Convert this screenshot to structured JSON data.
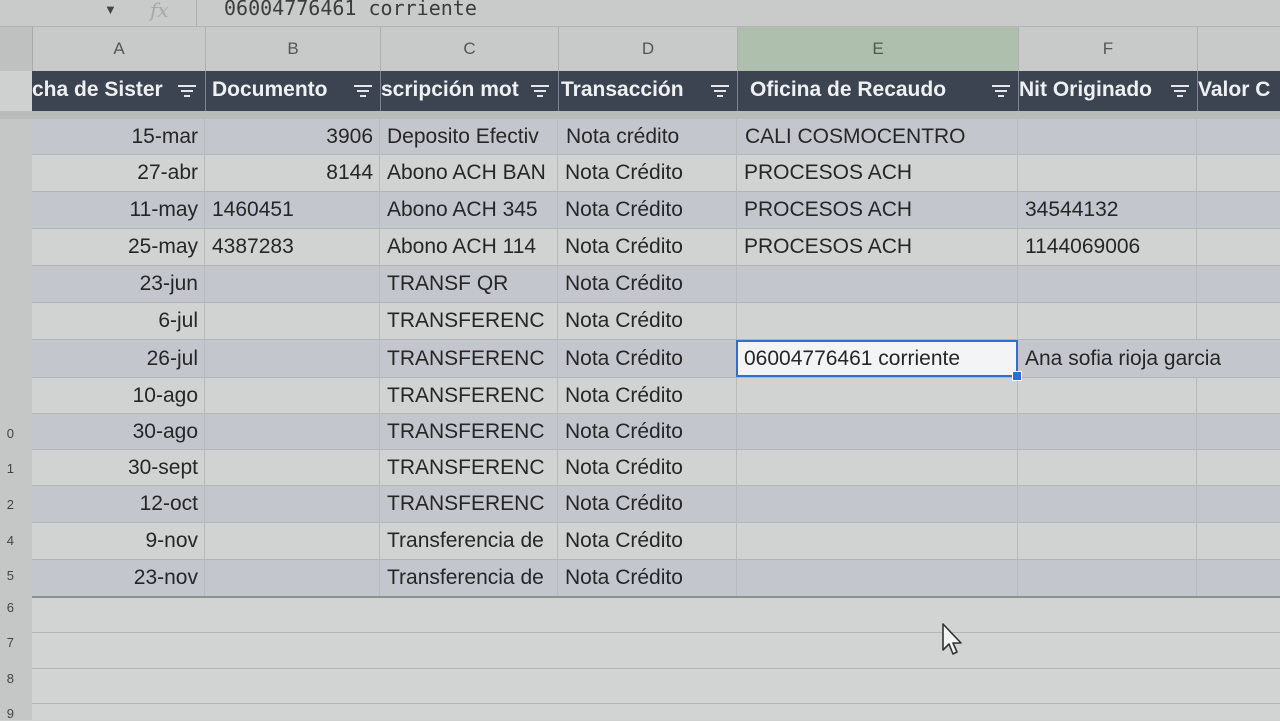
{
  "formula_bar": {
    "fx_label": "fx",
    "value": "06004776461 corriente"
  },
  "columns": [
    "A",
    "B",
    "C",
    "D",
    "E",
    "F"
  ],
  "filter_headers": [
    "cha de Sister",
    "Documento",
    "scripción mot",
    "Transacción",
    "Oficina de Recaudo",
    "Nit Originado",
    "Valor C"
  ],
  "rows": [
    {
      "num": "",
      "a": "15-mar",
      "b": "3906",
      "c": "Deposito Efectiv",
      "d": "Nota crédito",
      "e": "CALI COSMOCENTRO",
      "f": ""
    },
    {
      "num": "",
      "a": "27-abr",
      "b": "8144",
      "c": "Abono ACH BAN",
      "d": "Nota Crédito",
      "e": "PROCESOS ACH",
      "f": ""
    },
    {
      "num": "",
      "a": "11-may",
      "b": "1460451",
      "c": "Abono ACH 345",
      "d": "Nota Crédito",
      "e": "PROCESOS ACH",
      "f": "34544132"
    },
    {
      "num": "",
      "a": "25-may",
      "b": "4387283",
      "c": "Abono ACH 114",
      "d": "Nota Crédito",
      "e": "PROCESOS ACH",
      "f": "1144069006"
    },
    {
      "num": "",
      "a": "23-jun",
      "b": "",
      "c": "TRANSF QR",
      "d": "Nota Crédito",
      "e": "",
      "f": ""
    },
    {
      "num": "",
      "a": "6-jul",
      "b": "",
      "c": "TRANSFERENC",
      "d": "Nota Crédito",
      "e": "",
      "f": ""
    },
    {
      "num": "",
      "a": "26-jul",
      "b": "",
      "c": "TRANSFERENC",
      "d": "Nota Crédito",
      "e": "06004776461 corriente",
      "f": "Ana sofia rioja garcia"
    },
    {
      "num": "",
      "a": "10-ago",
      "b": "",
      "c": "TRANSFERENC",
      "d": "Nota Crédito",
      "e": "",
      "f": ""
    },
    {
      "num": "0",
      "a": "30-ago",
      "b": "",
      "c": "TRANSFERENC",
      "d": "Nota Crédito",
      "e": "",
      "f": ""
    },
    {
      "num": "1",
      "a": "30-sept",
      "b": "",
      "c": "TRANSFERENC",
      "d": "Nota Crédito",
      "e": "",
      "f": ""
    },
    {
      "num": "2",
      "a": "12-oct",
      "b": "",
      "c": "TRANSFERENC",
      "d": "Nota Crédito",
      "e": "",
      "f": ""
    },
    {
      "num": "4",
      "a": "9-nov",
      "b": "",
      "c": "Transferencia de",
      "d": "Nota Crédito",
      "e": "",
      "f": ""
    },
    {
      "num": "5",
      "a": "23-nov",
      "b": "",
      "c": "Transferencia de",
      "d": "Nota Crédito",
      "e": "",
      "f": ""
    }
  ],
  "empty_rows": [
    "6",
    "7",
    "8",
    "9"
  ],
  "colors": {
    "header_bg": "#3b4450",
    "band_bg": "#c3c7cd",
    "selection": "#2f6fd3"
  }
}
